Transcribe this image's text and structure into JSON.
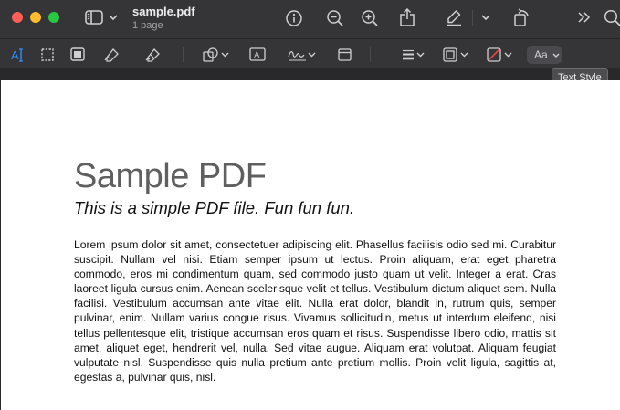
{
  "window": {
    "title": "sample.pdf",
    "subtitle": "1 page"
  },
  "toolbar": {
    "text_style_label": "Aa",
    "tooltip": "Text Style"
  },
  "icons": {
    "top": [
      "sidebar-icon",
      "chevron-down-icon",
      "info-icon",
      "zoom-out-icon",
      "zoom-in-icon",
      "share-icon",
      "highlight-pen-icon",
      "chevron-down-icon",
      "rotate-icon",
      "more-icon",
      "search-icon"
    ],
    "markup": [
      "text-selection-icon",
      "rect-selection-icon",
      "redact-icon",
      "sketch-icon",
      "draw-icon",
      "shapes-icon",
      "text-box-icon",
      "sign-icon",
      "note-icon",
      "shape-style-icon",
      "border-color-icon",
      "fill-color-icon",
      "text-style-icon"
    ]
  },
  "colors": {
    "accent": "#2f8cff",
    "fill_none_slash": "#e5463b",
    "close": "#ff5f57",
    "minimize": "#febc2e",
    "zoom": "#28c840"
  },
  "document": {
    "title": "Sample PDF",
    "subtitle": "This is a simple PDF file. Fun fun fun.",
    "body": "Lorem ipsum dolor sit amet, consectetuer adipiscing elit. Phasellus facilisis odio sed mi. Curabitur suscipit. Nullam vel nisi. Etiam semper ipsum ut lectus. Proin aliquam, erat eget pharetra commodo, eros mi condimentum quam, sed commodo justo quam ut velit. Integer a erat. Cras laoreet ligula cursus enim. Aenean scelerisque velit et tellus. Vestibulum dictum aliquet sem. Nulla facilisi. Vestibulum accumsan ante vitae elit. Nulla erat dolor, blandit in, rutrum quis, semper pulvinar, enim. Nullam varius congue risus. Vivamus sollicitudin, metus ut interdum eleifend, nisi tellus pellentesque elit, tristique accumsan eros quam et risus. Suspendisse libero odio, mattis sit amet, aliquet eget, hendrerit vel, nulla. Sed vitae augue. Aliquam erat volutpat. Aliquam feugiat vulputate nisl. Suspendisse quis nulla pretium ante pretium mollis. Proin velit ligula, sagittis at, egestas a, pulvinar quis, nisl."
  }
}
